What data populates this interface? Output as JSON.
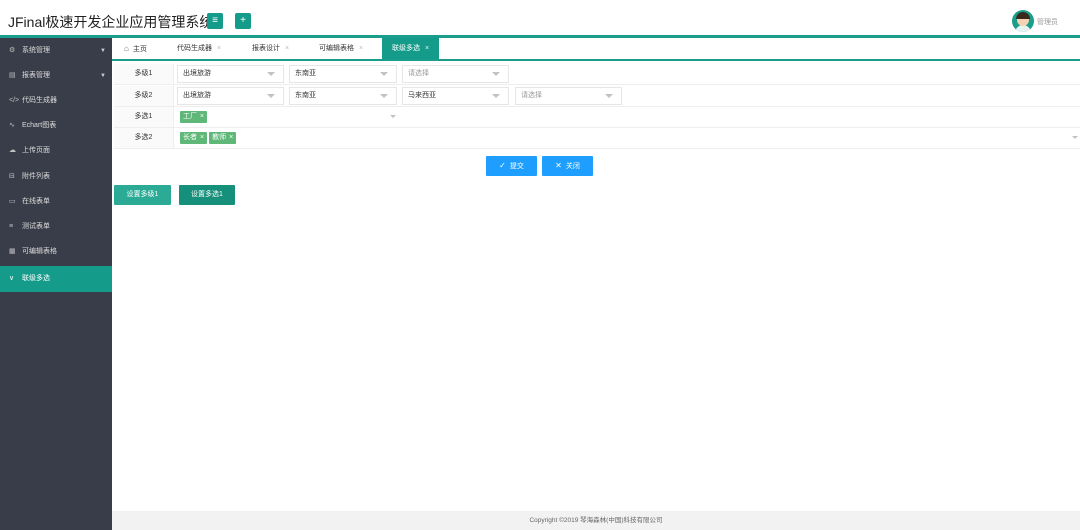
{
  "header": {
    "title": "JFinal极速开发企业应用管理系统",
    "menu_icon": "≡",
    "add_icon": "+",
    "user_name": "管理员"
  },
  "sidebar": {
    "items": [
      {
        "icon": "gear-icon",
        "glyph": "⚙",
        "label": "系统管理",
        "has_arrow": true
      },
      {
        "icon": "report-icon",
        "glyph": "▤",
        "label": "报表管理",
        "has_arrow": true
      },
      {
        "icon": "code-icon",
        "glyph": "</>",
        "label": "代码生成器"
      },
      {
        "icon": "pulse-icon",
        "glyph": "∿",
        "label": "Echart图表"
      },
      {
        "icon": "upload-icon",
        "glyph": "☁",
        "label": "上传页面"
      },
      {
        "icon": "attachment-icon",
        "glyph": "⊟",
        "label": "附件列表"
      },
      {
        "icon": "form-icon",
        "glyph": "▭",
        "label": "在线表单"
      },
      {
        "icon": "list-icon",
        "glyph": "≡",
        "label": "测试表单"
      },
      {
        "icon": "table-icon",
        "glyph": "▦",
        "label": "可编辑表格"
      },
      {
        "icon": "chevron-down-icon",
        "glyph": "∨",
        "label": "联级多选",
        "active": true
      }
    ]
  },
  "tabs": [
    {
      "label": "主页",
      "home": true
    },
    {
      "label": "代码生成器",
      "close": "×"
    },
    {
      "label": "报表设计",
      "close": "×"
    },
    {
      "label": "可编辑表格",
      "close": "×"
    },
    {
      "label": "联级多选",
      "close": "×",
      "active": true
    }
  ],
  "form": {
    "rows": [
      {
        "label": "多级1",
        "selects": [
          {
            "value": "出境旅游"
          },
          {
            "value": "东南亚"
          },
          {
            "value": "请选择",
            "placeholder": true
          }
        ]
      },
      {
        "label": "多级2",
        "selects": [
          {
            "value": "出境旅游"
          },
          {
            "value": "东南亚"
          },
          {
            "value": "马来西亚"
          },
          {
            "value": "请选择",
            "placeholder": true
          }
        ]
      },
      {
        "label": "多选1",
        "tags": [
          "工厂"
        ]
      },
      {
        "label": "多选2",
        "tags": [
          "长者",
          "教师"
        ]
      }
    ],
    "tag_close": "×",
    "submit_label": "提交",
    "close_label": "关闭"
  },
  "actions": {
    "set_cascade_label": "设置多级1",
    "set_multi_label": "设置多选1"
  },
  "footer": {
    "copyright": "Copyright ©2019 琴海森林(中国)科技有限公司"
  },
  "colors": {
    "primary": "#159b8a",
    "sidebar_bg": "#393d49",
    "blue": "#1e9fff",
    "tag_green": "#5fb878"
  }
}
